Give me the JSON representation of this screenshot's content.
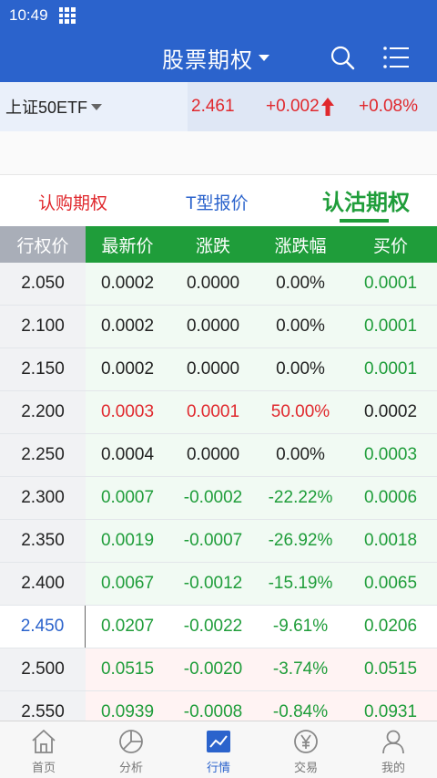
{
  "status": {
    "time": "10:49"
  },
  "header": {
    "title": "股票期权"
  },
  "quote": {
    "symbol": "上证50ETF",
    "price": "2.461",
    "change": "+0.002",
    "pct": "+0.08%"
  },
  "tabs": {
    "call": "认购期权",
    "t_quote": "T型报价",
    "put": "认沽期权"
  },
  "columns": [
    "行权价",
    "最新价",
    "涨跌",
    "涨跌幅",
    "买价"
  ],
  "rows": [
    {
      "strike": "2.050",
      "last": "0.0002",
      "chg": "0.0000",
      "pct": "0.00%",
      "bid": "0.0001",
      "state": "in",
      "color": "black"
    },
    {
      "strike": "2.100",
      "last": "0.0002",
      "chg": "0.0000",
      "pct": "0.00%",
      "bid": "0.0001",
      "state": "in",
      "color": "black"
    },
    {
      "strike": "2.150",
      "last": "0.0002",
      "chg": "0.0000",
      "pct": "0.00%",
      "bid": "0.0001",
      "state": "in",
      "color": "black"
    },
    {
      "strike": "2.200",
      "last": "0.0003",
      "chg": "0.0001",
      "pct": "50.00%",
      "bid": "0.0002",
      "state": "in",
      "color": "red"
    },
    {
      "strike": "2.250",
      "last": "0.0004",
      "chg": "0.0000",
      "pct": "0.00%",
      "bid": "0.0003",
      "state": "in",
      "color": "black"
    },
    {
      "strike": "2.300",
      "last": "0.0007",
      "chg": "-0.0002",
      "pct": "-22.22%",
      "bid": "0.0006",
      "state": "in",
      "color": "green"
    },
    {
      "strike": "2.350",
      "last": "0.0019",
      "chg": "-0.0007",
      "pct": "-26.92%",
      "bid": "0.0018",
      "state": "in",
      "color": "green"
    },
    {
      "strike": "2.400",
      "last": "0.0067",
      "chg": "-0.0012",
      "pct": "-15.19%",
      "bid": "0.0065",
      "state": "in",
      "color": "green"
    },
    {
      "strike": "2.450",
      "last": "0.0207",
      "chg": "-0.0022",
      "pct": "-9.61%",
      "bid": "0.0206",
      "state": "current",
      "color": "green"
    },
    {
      "strike": "2.500",
      "last": "0.0515",
      "chg": "-0.0020",
      "pct": "-3.74%",
      "bid": "0.0515",
      "state": "out",
      "color": "green"
    },
    {
      "strike": "2.550",
      "last": "0.0939",
      "chg": "-0.0008",
      "pct": "-0.84%",
      "bid": "0.0931",
      "state": "out",
      "color": "green"
    }
  ],
  "nav": [
    {
      "label": "首页",
      "icon": "home-icon"
    },
    {
      "label": "分析",
      "icon": "pie-chart-icon"
    },
    {
      "label": "行情",
      "icon": "trend-chart-icon"
    },
    {
      "label": "交易",
      "icon": "yen-coin-icon"
    },
    {
      "label": "我的",
      "icon": "user-icon"
    }
  ],
  "colors": {
    "primary": "#2b63cc",
    "up": "#e0282d",
    "down": "#1f9d3a"
  }
}
